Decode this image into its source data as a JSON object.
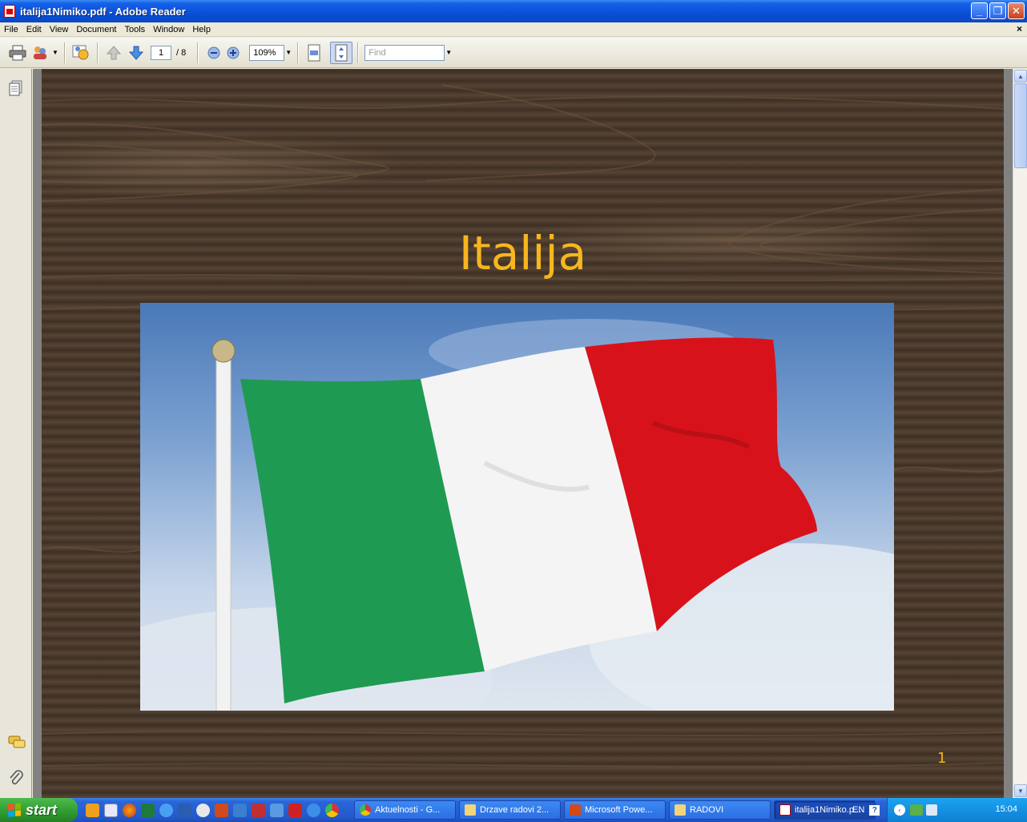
{
  "window": {
    "title": "italija1Nimiko.pdf - Adobe Reader",
    "minimize": "_",
    "restore": "❐",
    "close": "✕"
  },
  "menu": {
    "items": [
      "File",
      "Edit",
      "View",
      "Document",
      "Tools",
      "Window",
      "Help"
    ],
    "close_glyph": "×"
  },
  "toolbar": {
    "current_page": "1",
    "page_total": "/ 8",
    "zoom": "109%",
    "find_placeholder": "Find"
  },
  "slide": {
    "title": "Italija",
    "number": "1"
  },
  "taskbar": {
    "start_label": "start",
    "tasks": [
      {
        "label": "Aktuelnosti - G...",
        "icon": "chrome-icon"
      },
      {
        "label": "Drzave radovi 2...",
        "icon": "folder-icon"
      },
      {
        "label": "Microsoft Powe...",
        "icon": "powerpoint-icon"
      },
      {
        "label": "RADOVI",
        "icon": "folder-icon"
      },
      {
        "label": "italija1Nimiko.p...",
        "icon": "pdf-icon"
      }
    ],
    "language": "EN",
    "clock": "15:04"
  },
  "colors": {
    "slide_title": "#f6b61e",
    "flag_green": "#1f9a52",
    "flag_white": "#f4f4f4",
    "flag_red": "#d8121b",
    "wood": "#4b3a2c"
  }
}
